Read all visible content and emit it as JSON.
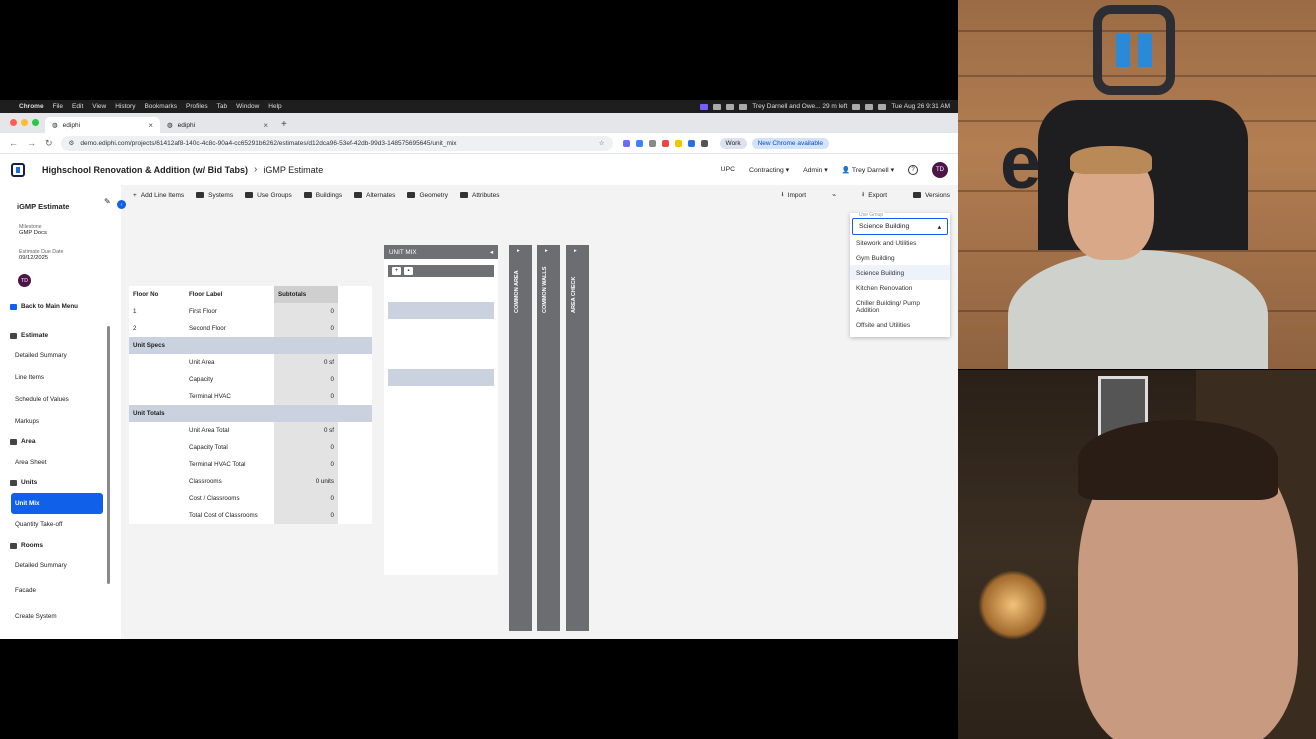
{
  "mac_menubar": {
    "app": "Chrome",
    "menus": [
      "File",
      "Edit",
      "View",
      "History",
      "Bookmarks",
      "Profiles",
      "Tab",
      "Window",
      "Help"
    ],
    "meeting": "Trey Darnell and Owe... 29 m left",
    "datetime": "Tue Aug 26 9:31 AM"
  },
  "browser": {
    "tabs": [
      {
        "label": "ediphi",
        "active": true
      },
      {
        "label": "ediphi",
        "active": false
      }
    ],
    "url": "demo.ediphi.com/projects/61412af8-140c-4c8c-90a4-cc65291b6262/estimates/d12dca96-53ef-42db-99d3-148575695645/unit_mix",
    "work_label": "Work",
    "update_label": "New Chrome available"
  },
  "header": {
    "project": "Highschool Renovation & Addition (w/ Bid Tabs)",
    "page": "iGMP Estimate",
    "nav": [
      "UPC",
      "Contracting",
      "Admin"
    ],
    "user": "Trey Darnell",
    "initials": "TD"
  },
  "sidebar": {
    "title": "iGMP Estimate",
    "milestone_label": "Milestone",
    "milestone_value": "GMP Docs",
    "due_label": "Estimate Due Date",
    "due_value": "09/12/2025",
    "initials": "TD",
    "back": "Back to Main Menu",
    "estimate_section": "Estimate",
    "estimate_items": [
      "Detailed Summary",
      "Line Items",
      "Schedule of Values",
      "Markups"
    ],
    "area_section": "Area",
    "area_items": [
      "Area Sheet"
    ],
    "units_section": "Units",
    "units_active": "Unit Mix",
    "units_items": [
      "Quantity Take-off"
    ],
    "rooms_section": "Rooms",
    "rooms_items": [
      "Detailed Summary"
    ],
    "other_items": [
      "Facade",
      "Create System"
    ]
  },
  "toolbar": {
    "items": [
      "Add Line Items",
      "Systems",
      "Use Groups",
      "Buildings",
      "Alternates",
      "Geometry",
      "Attributes"
    ],
    "right": [
      "Import",
      "Export",
      "Versions"
    ]
  },
  "floor_table": {
    "headers": [
      "Floor No",
      "Floor Label",
      "Subtotals"
    ],
    "floors": [
      {
        "no": "1",
        "label": "First Floor",
        "subtotal": "0"
      },
      {
        "no": "2",
        "label": "Second Floor",
        "subtotal": "0"
      }
    ],
    "unit_specs_label": "Unit Specs",
    "unit_specs": [
      {
        "label": "Unit Area",
        "value": "0 sf"
      },
      {
        "label": "Capacity",
        "value": "0"
      },
      {
        "label": "Terminal HVAC",
        "value": "0"
      }
    ],
    "unit_totals_label": "Unit Totals",
    "unit_totals": [
      {
        "label": "Unit Area Total",
        "value": "0 sf"
      },
      {
        "label": "Capacity Total",
        "value": "0"
      },
      {
        "label": "Terminal HVAC Total",
        "value": "0"
      },
      {
        "label": "Classrooms",
        "value": "0 units"
      },
      {
        "label": "Cost / Classrooms",
        "value": "0"
      },
      {
        "label": "Total Cost of Classrooms",
        "value": "0"
      }
    ]
  },
  "unit_mix": {
    "title": "UNIT MIX",
    "columns": [
      "COMMON AREA",
      "COMMON WALLS",
      "AREA CHECK"
    ]
  },
  "use_group": {
    "label": "Use Group",
    "selected": "Science Building",
    "options": [
      "Sitework and Utilities",
      "Gym Building",
      "Science Building",
      "Kitchen Renovation",
      "Chiller Building/ Pump Addition",
      "Offsite and Utilities"
    ]
  },
  "webcam": {
    "brand": "ediphi"
  },
  "colors": {
    "accent": "#1160ea",
    "avatar": "#4b1548",
    "column_header": "#6e7074"
  }
}
